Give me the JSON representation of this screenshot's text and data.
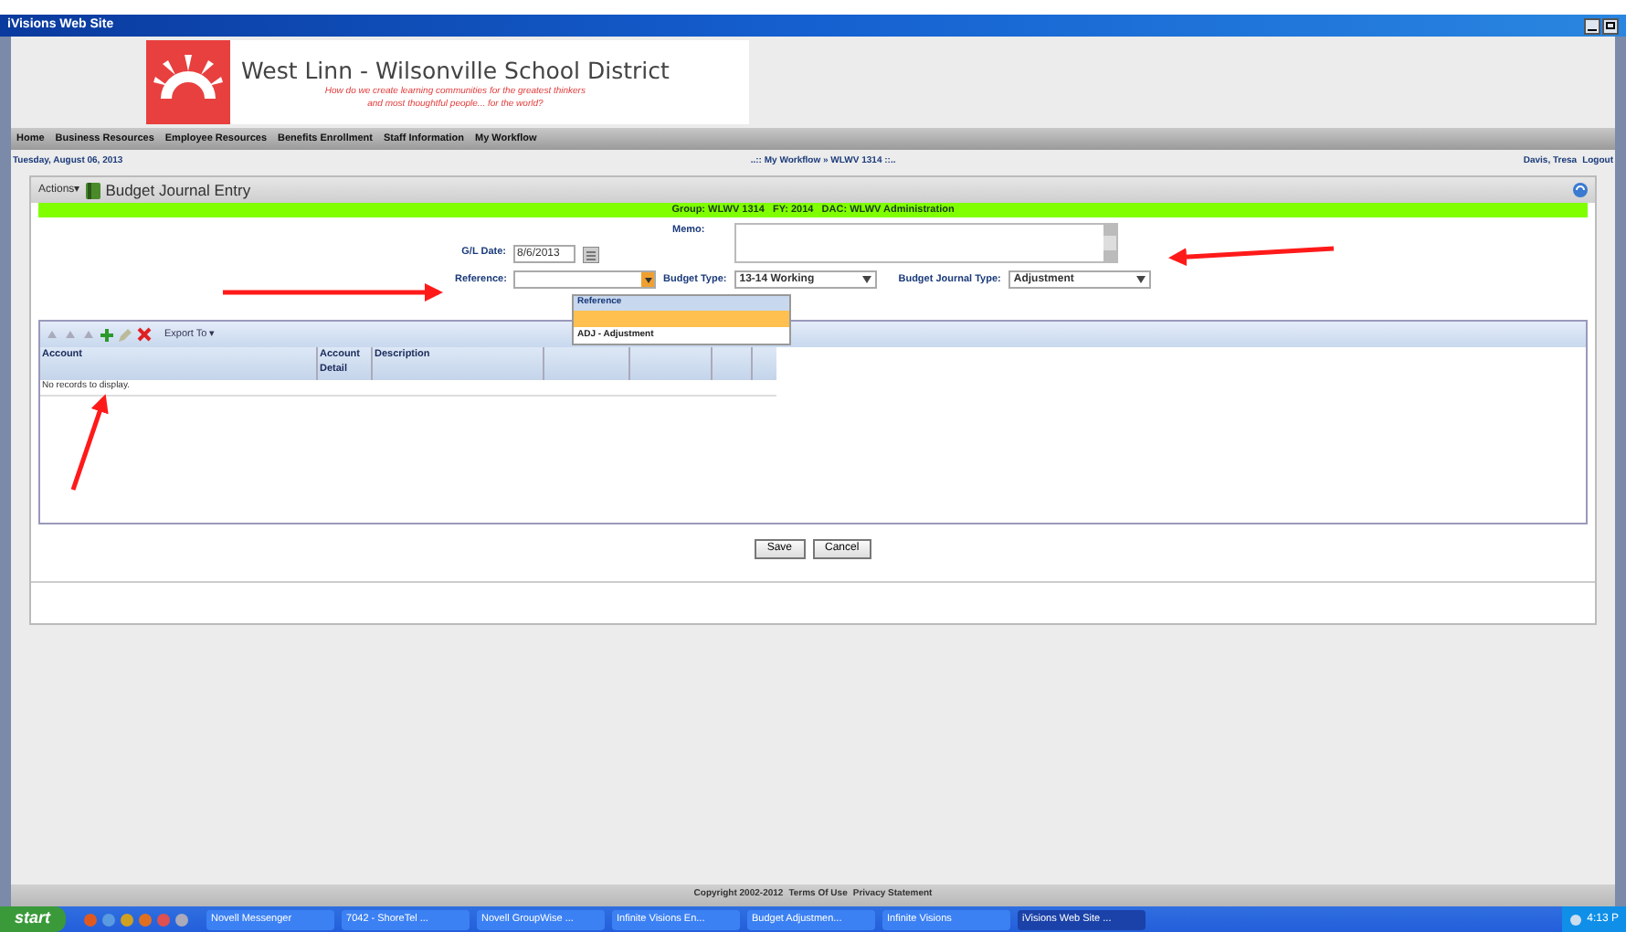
{
  "window": {
    "title": "iVisions Web Site"
  },
  "banner": {
    "title": "West Linn - Wilsonville School District",
    "tagline": "How do we create learning communities for the greatest thinkers",
    "tagline_2": "and most thoughtful people... for the world?"
  },
  "nav": [
    {
      "label": "Home"
    },
    {
      "label": "Business Resources"
    },
    {
      "label": "Employee Resources"
    },
    {
      "label": "Benefits Enrollment"
    },
    {
      "label": "Staff Information"
    },
    {
      "label": "My Workflow"
    }
  ],
  "info": {
    "date": "Tuesday, August 06, 2013",
    "breadcrumb": "..:: My Workflow » WLWV 1314 ::..",
    "user": "Davis, Tresa",
    "logout": "Logout"
  },
  "panel": {
    "actions": "Actions",
    "caret": "▾",
    "title": "Budget Journal Entry",
    "group_bar": "Group: WLWV 1314   FY: 2014   DAC: WLWV Administration"
  },
  "form": {
    "gl_date_label": "G/L Date:",
    "gl_date": "8/6/2013",
    "memo_label": "Memo:",
    "reference_label": "Reference:",
    "budget_type_label": "Budget Type:",
    "budget_type": "13-14 Working",
    "journal_type_label": "Budget Journal Type:",
    "journal_type": "Adjustment"
  },
  "reference_dropdown": {
    "expanded": true,
    "header": "Reference",
    "options": [
      {
        "label": "ADJ - Adjustment",
        "selected": false
      }
    ]
  },
  "grid": {
    "export_label": "Export To",
    "export_caret": "▾",
    "columns": [
      "Account",
      "Account Detail",
      "Description"
    ],
    "empty_text": "No records to display."
  },
  "buttons": [
    "Save",
    "Cancel"
  ],
  "footer": [
    "Copyright 2002-2012",
    "Terms Of Use",
    "Privacy Statement"
  ],
  "taskbar": {
    "start": "start",
    "items": [
      {
        "label": "Novell Messenger",
        "selected": false
      },
      {
        "label": "7042 - ShoreTel ...",
        "selected": false
      },
      {
        "label": "Novell GroupWise ...",
        "selected": false
      },
      {
        "label": "Infinite Visions En...",
        "selected": false
      },
      {
        "label": "Budget Adjustmen...",
        "selected": false
      },
      {
        "label": "Infinite Visions",
        "selected": false
      },
      {
        "label": "iVisions Web Site ...",
        "selected": true
      }
    ],
    "clock": "4:13 P"
  }
}
